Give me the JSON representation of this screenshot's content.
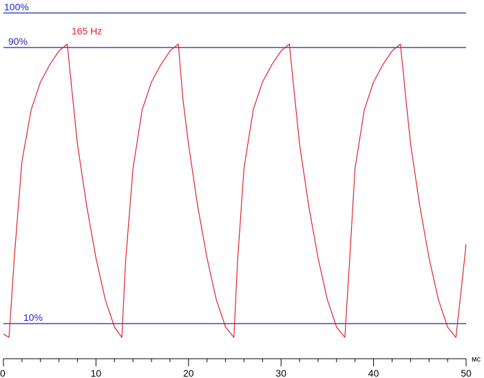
{
  "chart_data": {
    "type": "line",
    "title": "",
    "xlabel": "",
    "ylabel": "",
    "x_unit": "мс",
    "xlim": [
      0,
      50
    ],
    "ylim": [
      0,
      100
    ],
    "x_ticks": [
      0,
      10,
      20,
      30,
      40,
      50
    ],
    "x_tick_labels": [
      "0",
      "10",
      "20",
      "30",
      "40",
      "50"
    ],
    "x_minor_step": 2,
    "reference_lines": [
      {
        "value": 100,
        "label": "100%",
        "color": "#1f1fc2"
      },
      {
        "value": 90,
        "label": "90%",
        "color": "#1f1fc2"
      },
      {
        "value": 10,
        "label": "10%",
        "color": "#1f1fc2"
      }
    ],
    "series": [
      {
        "name": "165 Hz",
        "color": "#e0202a",
        "x": [
          0,
          0.6,
          1.2,
          2,
          3,
          4,
          5,
          6,
          6.9,
          7.5,
          8,
          9,
          10,
          11,
          12,
          12.8,
          13.2,
          14,
          15,
          16,
          17,
          18,
          18.9,
          19.4,
          20,
          21,
          22,
          23,
          24,
          24.9,
          25.3,
          26,
          27,
          28,
          29,
          30,
          30.9,
          31.5,
          32,
          33,
          34,
          35,
          36,
          36.9,
          37.4,
          38,
          39,
          40,
          41,
          42,
          42.9,
          43.5,
          44,
          45,
          46,
          47,
          48,
          48.9,
          49.4,
          50
        ],
        "y": [
          7,
          6,
          30,
          57,
          72,
          80,
          85,
          89,
          91,
          75,
          62,
          44,
          29,
          17,
          9,
          6,
          28,
          55,
          72,
          80,
          85,
          89,
          91,
          75,
          62,
          44,
          29,
          17,
          9,
          6,
          28,
          55,
          72,
          80,
          85,
          89,
          91,
          75,
          62,
          44,
          29,
          17,
          9,
          6,
          28,
          55,
          72,
          80,
          85,
          89,
          91,
          75,
          62,
          44,
          29,
          17,
          9,
          6,
          18,
          33
        ]
      }
    ]
  }
}
